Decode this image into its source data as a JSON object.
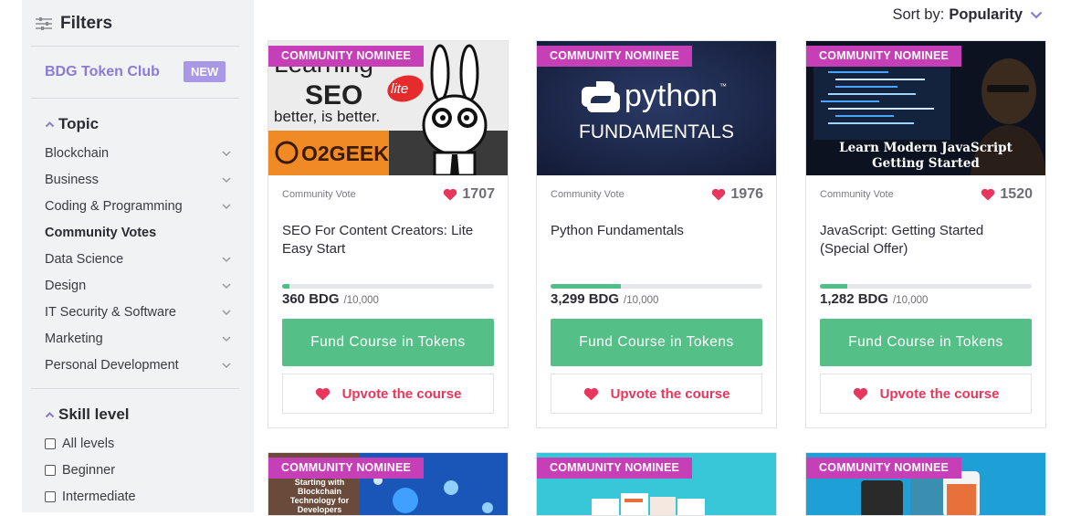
{
  "sidebar": {
    "filters_title": "Filters",
    "token_club": "BDG Token Club",
    "new_badge": "NEW",
    "topic_title": "Topic",
    "topics": [
      {
        "label": "Blockchain"
      },
      {
        "label": "Business"
      },
      {
        "label": "Coding & Programming"
      },
      {
        "label": "Community Votes"
      },
      {
        "label": "Data Science"
      },
      {
        "label": "Design"
      },
      {
        "label": "IT Security & Software"
      },
      {
        "label": "Marketing"
      },
      {
        "label": "Personal Development"
      }
    ],
    "skill_title": "Skill level",
    "skills": [
      {
        "label": "All levels",
        "checked": false
      },
      {
        "label": "Beginner",
        "checked": false
      },
      {
        "label": "Intermediate",
        "checked": false
      }
    ]
  },
  "sort": {
    "label": "Sort by:",
    "value": "Popularity"
  },
  "colors": {
    "accent": "#8b7ad6",
    "badge": "#c73fb6",
    "fund": "#55bf88",
    "upvote": "#e8365c"
  },
  "cards": [
    {
      "badge": "COMMUNITY NOMINEE",
      "vote_label": "Community Vote",
      "votes": "1707",
      "title": "SEO For Content Creators: Lite Easy Start",
      "amount": "360 BDG",
      "goal": "/10,000",
      "progress": 0.036,
      "fund_label": "Fund Course in Tokens",
      "upvote_label": "Upvote the course",
      "thumb": {
        "line1": "Learning",
        "line2": "SEO",
        "line3": "better, is better.",
        "lite": "lite",
        "brand": "O2GEEK"
      }
    },
    {
      "badge": "COMMUNITY NOMINEE",
      "vote_label": "Community Vote",
      "votes": "1976",
      "title": "Python Fundamentals",
      "amount": "3,299 BDG",
      "goal": "/10,000",
      "progress": 0.33,
      "fund_label": "Fund Course in Tokens",
      "upvote_label": "Upvote the course",
      "thumb": {
        "line1": "python",
        "tm": "™",
        "line2": "FUNDAMENTALS"
      }
    },
    {
      "badge": "COMMUNITY NOMINEE",
      "vote_label": "Community Vote",
      "votes": "1520",
      "title": "JavaScript: Getting Started (Special Offer)",
      "amount": "1,282 BDG",
      "goal": "/10,000",
      "progress": 0.128,
      "fund_label": "Fund Course in Tokens",
      "upvote_label": "Upvote the course",
      "thumb": {
        "line1": "Learn Modern JavaScript",
        "line2": "Getting Started"
      }
    }
  ],
  "cards_row2": [
    {
      "badge": "COMMUNITY NOMINEE",
      "thumb_text": [
        "Starting with",
        "Blockchain",
        "Technology for",
        "Developers"
      ]
    },
    {
      "badge": "COMMUNITY NOMINEE"
    },
    {
      "badge": "COMMUNITY NOMINEE"
    }
  ]
}
